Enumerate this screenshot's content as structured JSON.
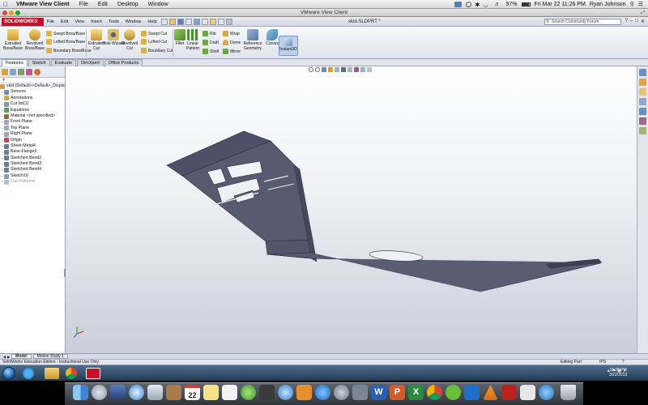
{
  "mac_menubar": {
    "app_name": "VMware View Client",
    "menus": [
      "File",
      "Edit",
      "Desktop",
      "Window"
    ],
    "battery": "97%",
    "datetime": "Fri Mar 22  11:26 PM",
    "user": "Ryan Johnson"
  },
  "window": {
    "title": "VMware View Client"
  },
  "solidworks": {
    "logo": "SOLIDWORKS",
    "menus": [
      "File",
      "Edit",
      "View",
      "Insert",
      "Tools",
      "Window",
      "Help"
    ],
    "document_title": "skid.SLDPRT *",
    "search_placeholder": "Search Community Forum"
  },
  "ribbon": {
    "extruded_boss": "Extruded Boss/Base",
    "revolved_boss": "Revolved Boss/Base",
    "swept_boss": "Swept Boss/Base",
    "lofted_boss": "Lofted Boss/Base",
    "boundary_boss": "Boundary Boss/Base",
    "extruded_cut": "Extruded Cut",
    "hole_wizard": "Hole Wizard",
    "revolved_cut": "Revolved Cut",
    "swept_cut": "Swept Cut",
    "lofted_cut": "Lofted Cut",
    "boundary_cut": "Boundary Cut",
    "fillet": "Fillet",
    "linear_pattern": "Linear Pattern",
    "rib": "Rib",
    "draft": "Draft",
    "shell": "Shell",
    "wrap": "Wrap",
    "dome": "Dome",
    "mirror": "Mirror",
    "reference_geometry": "Reference Geometry",
    "curves": "Curves",
    "instant3d": "Instant3D"
  },
  "command_tabs": [
    "Features",
    "Sketch",
    "Evaluate",
    "DimXpert",
    "Office Products"
  ],
  "feature_tree": [
    {
      "label": "skid  (Default<<Default>_Display",
      "disabled": false,
      "color": "#c9a24a"
    },
    {
      "label": "Sensors",
      "disabled": false,
      "color": "#6f8fb8"
    },
    {
      "label": "Annotations",
      "disabled": false,
      "color": "#d4a437"
    },
    {
      "label": "Cut list(1)",
      "disabled": false,
      "color": "#7c95b5"
    },
    {
      "label": "Equations",
      "disabled": false,
      "color": "#58a05a"
    },
    {
      "label": "Material <not specified>",
      "disabled": false,
      "color": "#8d6a46"
    },
    {
      "label": "Front Plane",
      "disabled": false,
      "color": "#9aa8bb"
    },
    {
      "label": "Top Plane",
      "disabled": false,
      "color": "#9aa8bb"
    },
    {
      "label": "Right Plane",
      "disabled": false,
      "color": "#9aa8bb"
    },
    {
      "label": "Origin",
      "disabled": false,
      "color": "#c74a4a"
    },
    {
      "label": "Sheet-Metal4",
      "disabled": false,
      "color": "#6d7b91"
    },
    {
      "label": "Base-Flange3",
      "disabled": false,
      "color": "#6d7b91"
    },
    {
      "label": "Sketched Bend2",
      "disabled": false,
      "color": "#6d7b91"
    },
    {
      "label": "Sketched Bend3",
      "disabled": false,
      "color": "#6d7b91"
    },
    {
      "label": "Sketched Bend4",
      "disabled": false,
      "color": "#6d7b91"
    },
    {
      "label": "Sketch10",
      "disabled": false,
      "color": "#8b9bb2"
    },
    {
      "label": "Flat-Pattern4",
      "disabled": true,
      "color": "#b5bdca"
    }
  ],
  "bottom_tabs": [
    "Model",
    "Motion Study 1"
  ],
  "status": {
    "edition": "SolidWorks Education Edition - Instructional Use Only",
    "mode": "Editing Part",
    "units": "IPS"
  },
  "taskbar": {
    "time": "11:26 PM",
    "date": "3/22/2013"
  },
  "dock": {
    "calendar_day": "22"
  }
}
